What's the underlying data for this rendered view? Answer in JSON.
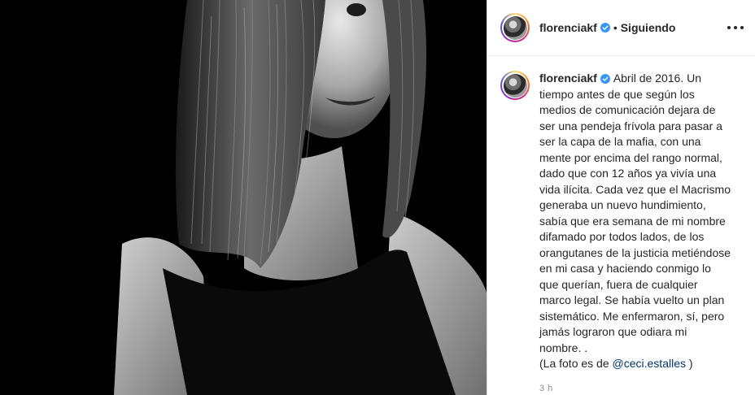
{
  "post": {
    "author": {
      "username": "florenciakf",
      "verified": true,
      "follow_status": "Siguiendo",
      "separator": "•"
    },
    "caption": {
      "text": "Abril de 2016. Un tiempo antes de que según los medios de comunicación dejara de ser una pendeja frívola para pasar a ser la capa de la mafia, con una mente por encima del rango normal, dado que con 12 años ya vivía una vida ilícita. Cada vez que el Macrismo generaba un nuevo hundimiento, sabía que era semana de mi nombre difamado por todos lados, de los orangutanes de la justicia metiéndose en mi casa y haciendo conmigo lo que querían, fuera de cualquier marco legal. Se había vuelto un plan sistemático. Me enfermaron, sí, pero jamás lograron que odiara mi nombre. .",
      "credit_prefix": "(La foto es de ",
      "credit_mention": "@ceci.estalles",
      "credit_suffix": " )"
    },
    "timestamp": "3 h"
  },
  "colors": {
    "verified_blue": "#3897f0",
    "text_primary": "#262626",
    "text_secondary": "#8e8e8e",
    "mention": "#00376b"
  },
  "icons": {
    "verified": "verified-badge-icon",
    "more": "more-options-icon"
  }
}
